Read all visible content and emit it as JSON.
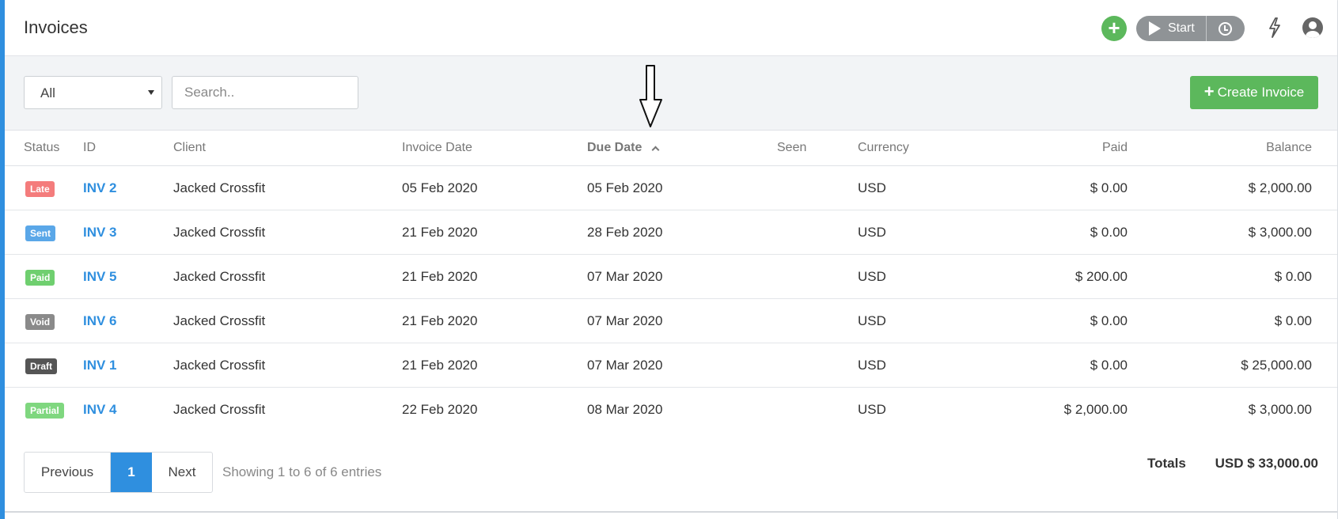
{
  "header": {
    "title": "Invoices",
    "start_label": "Start"
  },
  "toolbar": {
    "filter_value": "All",
    "search_placeholder": "Search..",
    "create_label": "Create Invoice"
  },
  "table": {
    "columns": {
      "status": "Status",
      "id": "ID",
      "client": "Client",
      "invoice_date": "Invoice Date",
      "due_date": "Due Date",
      "seen": "Seen",
      "currency": "Currency",
      "paid": "Paid",
      "balance": "Balance"
    },
    "sorted_by": "Due Date",
    "sort_direction": "ascending",
    "rows": [
      {
        "status": "Late",
        "status_color": "#f47c7c",
        "id": "INV 2",
        "client": "Jacked Crossfit",
        "invoice_date": "05 Feb 2020",
        "due_date": "05 Feb 2020",
        "seen": "",
        "currency": "USD",
        "paid": "$ 0.00",
        "balance": "$ 2,000.00"
      },
      {
        "status": "Sent",
        "status_color": "#5aa7e8",
        "id": "INV 3",
        "client": "Jacked Crossfit",
        "invoice_date": "21 Feb 2020",
        "due_date": "28 Feb 2020",
        "seen": "",
        "currency": "USD",
        "paid": "$ 0.00",
        "balance": "$ 3,000.00"
      },
      {
        "status": "Paid",
        "status_color": "#6fcf6f",
        "id": "INV 5",
        "client": "Jacked Crossfit",
        "invoice_date": "21 Feb 2020",
        "due_date": "07 Mar 2020",
        "seen": "",
        "currency": "USD",
        "paid": "$ 200.00",
        "balance": "$ 0.00"
      },
      {
        "status": "Void",
        "status_color": "#8a8a8a",
        "id": "INV 6",
        "client": "Jacked Crossfit",
        "invoice_date": "21 Feb 2020",
        "due_date": "07 Mar 2020",
        "seen": "",
        "currency": "USD",
        "paid": "$ 0.00",
        "balance": "$ 0.00"
      },
      {
        "status": "Draft",
        "status_color": "#555555",
        "id": "INV 1",
        "client": "Jacked Crossfit",
        "invoice_date": "21 Feb 2020",
        "due_date": "07 Mar 2020",
        "seen": "",
        "currency": "USD",
        "paid": "$ 0.00",
        "balance": "$ 25,000.00"
      },
      {
        "status": "Partial",
        "status_color": "#7fd77f",
        "id": "INV 4",
        "client": "Jacked Crossfit",
        "invoice_date": "22 Feb 2020",
        "due_date": "08 Mar 2020",
        "seen": "",
        "currency": "USD",
        "paid": "$ 2,000.00",
        "balance": "$ 3,000.00"
      }
    ]
  },
  "footer": {
    "prev_label": "Previous",
    "current_page": "1",
    "next_label": "Next",
    "showing_text": "Showing 1 to 6 of 6 entries",
    "totals_label": "Totals",
    "totals_value": "USD $ 33,000.00"
  },
  "colors": {
    "accent": "#2f8fdf",
    "success": "#5cb85c"
  }
}
